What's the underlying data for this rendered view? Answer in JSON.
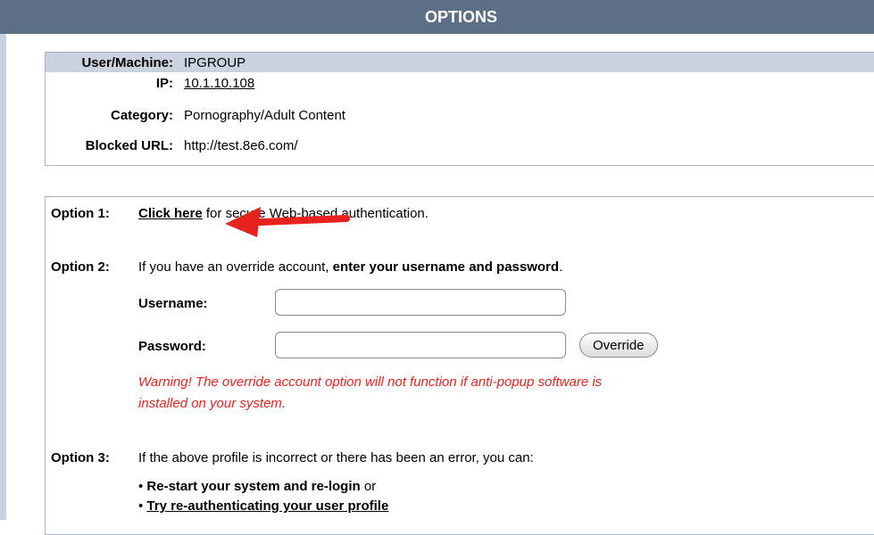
{
  "header": {
    "title": "OPTIONS"
  },
  "info": {
    "user_label": "User/Machine:",
    "user_value": "IPGROUP",
    "ip_label": "IP:",
    "ip_value": "10.1.10.108",
    "category_label": "Category:",
    "category_value": "Pornography/Adult Content",
    "blocked_label": "Blocked URL:",
    "blocked_value": "http://test.8e6.com/"
  },
  "option1": {
    "label": "Option 1:",
    "link": "Click here",
    "text": "for secure Web-based authentication."
  },
  "option2": {
    "label": "Option 2:",
    "text_plain": "If you have an override account, ",
    "text_bold": "enter your username and password",
    "text_end": ".",
    "username_label": "Username:",
    "username_value": "",
    "password_label": "Password:",
    "password_value": "",
    "override_button": "Override",
    "warning_line1": "Warning! The override account option will not function if anti-popup software is",
    "warning_line2": "installed on your system."
  },
  "option3": {
    "label": "Option 3:",
    "text": "If the above profile is incorrect or there has been an error, you can:",
    "bullet1_bold": "Re-start your system and re-login",
    "bullet1_end": " or",
    "bullet2_link": "Try re-authenticating your user profile"
  },
  "colors": {
    "header_bg": "#5d6f86",
    "warning": "#e8221e",
    "arrow": "#e8221e"
  }
}
